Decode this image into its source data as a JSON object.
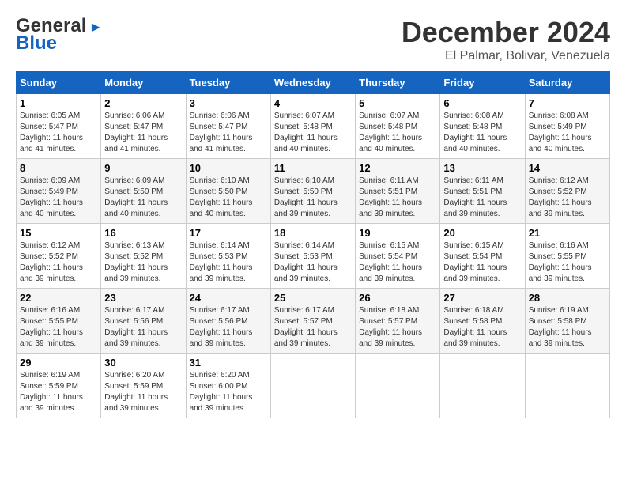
{
  "header": {
    "logo_general": "General",
    "logo_blue": "Blue",
    "month": "December 2024",
    "location": "El Palmar, Bolivar, Venezuela"
  },
  "weekdays": [
    "Sunday",
    "Monday",
    "Tuesday",
    "Wednesday",
    "Thursday",
    "Friday",
    "Saturday"
  ],
  "weeks": [
    [
      {
        "day": "1",
        "sunrise": "6:05 AM",
        "sunset": "5:47 PM",
        "daylight": "11 hours and 41 minutes."
      },
      {
        "day": "2",
        "sunrise": "6:06 AM",
        "sunset": "5:47 PM",
        "daylight": "11 hours and 41 minutes."
      },
      {
        "day": "3",
        "sunrise": "6:06 AM",
        "sunset": "5:47 PM",
        "daylight": "11 hours and 41 minutes."
      },
      {
        "day": "4",
        "sunrise": "6:07 AM",
        "sunset": "5:48 PM",
        "daylight": "11 hours and 40 minutes."
      },
      {
        "day": "5",
        "sunrise": "6:07 AM",
        "sunset": "5:48 PM",
        "daylight": "11 hours and 40 minutes."
      },
      {
        "day": "6",
        "sunrise": "6:08 AM",
        "sunset": "5:48 PM",
        "daylight": "11 hours and 40 minutes."
      },
      {
        "day": "7",
        "sunrise": "6:08 AM",
        "sunset": "5:49 PM",
        "daylight": "11 hours and 40 minutes."
      }
    ],
    [
      {
        "day": "8",
        "sunrise": "6:09 AM",
        "sunset": "5:49 PM",
        "daylight": "11 hours and 40 minutes."
      },
      {
        "day": "9",
        "sunrise": "6:09 AM",
        "sunset": "5:50 PM",
        "daylight": "11 hours and 40 minutes."
      },
      {
        "day": "10",
        "sunrise": "6:10 AM",
        "sunset": "5:50 PM",
        "daylight": "11 hours and 40 minutes."
      },
      {
        "day": "11",
        "sunrise": "6:10 AM",
        "sunset": "5:50 PM",
        "daylight": "11 hours and 39 minutes."
      },
      {
        "day": "12",
        "sunrise": "6:11 AM",
        "sunset": "5:51 PM",
        "daylight": "11 hours and 39 minutes."
      },
      {
        "day": "13",
        "sunrise": "6:11 AM",
        "sunset": "5:51 PM",
        "daylight": "11 hours and 39 minutes."
      },
      {
        "day": "14",
        "sunrise": "6:12 AM",
        "sunset": "5:52 PM",
        "daylight": "11 hours and 39 minutes."
      }
    ],
    [
      {
        "day": "15",
        "sunrise": "6:12 AM",
        "sunset": "5:52 PM",
        "daylight": "11 hours and 39 minutes."
      },
      {
        "day": "16",
        "sunrise": "6:13 AM",
        "sunset": "5:52 PM",
        "daylight": "11 hours and 39 minutes."
      },
      {
        "day": "17",
        "sunrise": "6:14 AM",
        "sunset": "5:53 PM",
        "daylight": "11 hours and 39 minutes."
      },
      {
        "day": "18",
        "sunrise": "6:14 AM",
        "sunset": "5:53 PM",
        "daylight": "11 hours and 39 minutes."
      },
      {
        "day": "19",
        "sunrise": "6:15 AM",
        "sunset": "5:54 PM",
        "daylight": "11 hours and 39 minutes."
      },
      {
        "day": "20",
        "sunrise": "6:15 AM",
        "sunset": "5:54 PM",
        "daylight": "11 hours and 39 minutes."
      },
      {
        "day": "21",
        "sunrise": "6:16 AM",
        "sunset": "5:55 PM",
        "daylight": "11 hours and 39 minutes."
      }
    ],
    [
      {
        "day": "22",
        "sunrise": "6:16 AM",
        "sunset": "5:55 PM",
        "daylight": "11 hours and 39 minutes."
      },
      {
        "day": "23",
        "sunrise": "6:17 AM",
        "sunset": "5:56 PM",
        "daylight": "11 hours and 39 minutes."
      },
      {
        "day": "24",
        "sunrise": "6:17 AM",
        "sunset": "5:56 PM",
        "daylight": "11 hours and 39 minutes."
      },
      {
        "day": "25",
        "sunrise": "6:17 AM",
        "sunset": "5:57 PM",
        "daylight": "11 hours and 39 minutes."
      },
      {
        "day": "26",
        "sunrise": "6:18 AM",
        "sunset": "5:57 PM",
        "daylight": "11 hours and 39 minutes."
      },
      {
        "day": "27",
        "sunrise": "6:18 AM",
        "sunset": "5:58 PM",
        "daylight": "11 hours and 39 minutes."
      },
      {
        "day": "28",
        "sunrise": "6:19 AM",
        "sunset": "5:58 PM",
        "daylight": "11 hours and 39 minutes."
      }
    ],
    [
      {
        "day": "29",
        "sunrise": "6:19 AM",
        "sunset": "5:59 PM",
        "daylight": "11 hours and 39 minutes."
      },
      {
        "day": "30",
        "sunrise": "6:20 AM",
        "sunset": "5:59 PM",
        "daylight": "11 hours and 39 minutes."
      },
      {
        "day": "31",
        "sunrise": "6:20 AM",
        "sunset": "6:00 PM",
        "daylight": "11 hours and 39 minutes."
      },
      null,
      null,
      null,
      null
    ]
  ],
  "labels": {
    "sunrise": "Sunrise:",
    "sunset": "Sunset:",
    "daylight": "Daylight:"
  }
}
